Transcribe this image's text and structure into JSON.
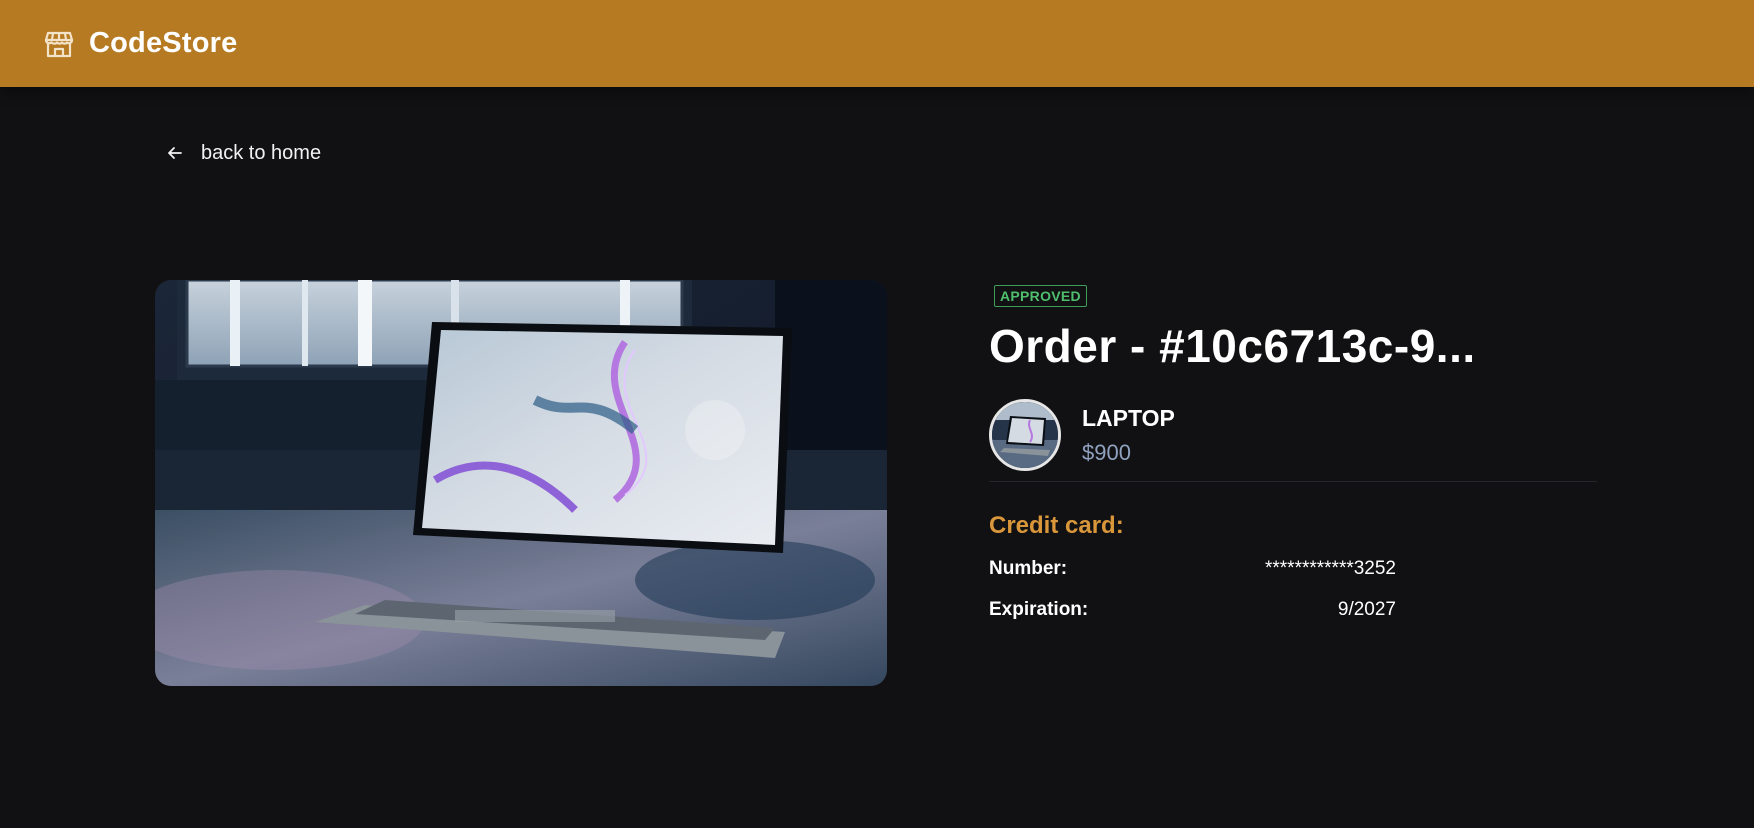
{
  "header": {
    "brand": "CodeStore",
    "logo_icon": "store-icon",
    "color": "#b67a22"
  },
  "nav": {
    "back_label": "back to home",
    "back_icon": "arrow-left-icon"
  },
  "product_image": {
    "subject": "laptop photo"
  },
  "order": {
    "status": "APPROVED",
    "status_color": "#4fbf6e",
    "title": "Order - #10c6713c-9...",
    "product": {
      "name": "LAPTOP",
      "price": "$900"
    },
    "credit_card": {
      "heading": "Credit card:",
      "number_label": "Number:",
      "number_value": "************3252",
      "expiration_label": "Expiration:",
      "expiration_value": "9/2027"
    }
  }
}
